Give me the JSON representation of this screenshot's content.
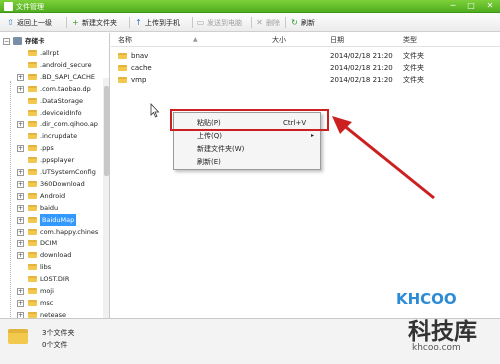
{
  "window": {
    "title": "文件管理",
    "minimize": "─",
    "maximize": "□",
    "close": "✕"
  },
  "toolbar": {
    "back": {
      "label": "返回上一级",
      "icon": "up-arrow-icon"
    },
    "new_folder": {
      "label": "新建文件夹",
      "icon": "plus-icon"
    },
    "upload": {
      "label": "上传到手机",
      "icon": "upload-icon"
    },
    "send": {
      "label": "发送到电脑",
      "icon": "send-icon"
    },
    "delete": {
      "label": "删除",
      "icon": "delete-icon"
    },
    "refresh": {
      "label": "刷新",
      "icon": "refresh-icon"
    }
  },
  "tree": {
    "root": "存储卡",
    "items": [
      {
        "label": ".allrpt",
        "expandable": false
      },
      {
        "label": ".android_secure",
        "expandable": false
      },
      {
        "label": ".BD_SAPI_CACHE",
        "expandable": true
      },
      {
        "label": ".com.taobao.dp",
        "expandable": true
      },
      {
        "label": ".DataStorage",
        "expandable": false
      },
      {
        "label": ".deviceidInfo",
        "expandable": false
      },
      {
        "label": ".dir_com.qihoo.ap",
        "expandable": true
      },
      {
        "label": ".incrupdate",
        "expandable": false
      },
      {
        "label": ".pps",
        "expandable": true
      },
      {
        "label": ".ppsplayer",
        "expandable": false
      },
      {
        "label": ".UTSystemConfig",
        "expandable": true
      },
      {
        "label": "360Download",
        "expandable": true
      },
      {
        "label": "Android",
        "expandable": true
      },
      {
        "label": "baidu",
        "expandable": true
      },
      {
        "label": "BaiduMap",
        "expandable": true,
        "selected": true
      },
      {
        "label": "com.happy.chines",
        "expandable": true
      },
      {
        "label": "DCIM",
        "expandable": true
      },
      {
        "label": "download",
        "expandable": true
      },
      {
        "label": "libs",
        "expandable": false
      },
      {
        "label": "LOST.DIR",
        "expandable": false
      },
      {
        "label": "moji",
        "expandable": true
      },
      {
        "label": "msc",
        "expandable": true
      },
      {
        "label": "netease",
        "expandable": true
      }
    ]
  },
  "list": {
    "columns": [
      "名称",
      "大小",
      "日期",
      "类型"
    ],
    "rows": [
      {
        "name": "bnav",
        "size": "",
        "date": "2014/02/18 21:20",
        "type": "文件夹"
      },
      {
        "name": "cache",
        "size": "",
        "date": "2014/02/18 21:20",
        "type": "文件夹"
      },
      {
        "name": "vmp",
        "size": "",
        "date": "2014/02/18 21:20",
        "type": "文件夹"
      }
    ]
  },
  "context_menu": {
    "items": [
      {
        "label": "粘贴(P)",
        "shortcut": "Ctrl+V"
      },
      {
        "label": "上传(Q)",
        "submenu_arrow": "▸"
      },
      {
        "label": "新建文件夹(W)"
      },
      {
        "label": "刷新(E)"
      }
    ]
  },
  "status": {
    "line1": "3个文件夹",
    "line2": "0个文件"
  },
  "watermark": {
    "logo": "KHCOO",
    "cn": "科技库",
    "en": "khcoo.com"
  },
  "colors": {
    "titlebar": "#5cba2a",
    "highlight": "#cc2020",
    "selection": "#3399ff"
  }
}
